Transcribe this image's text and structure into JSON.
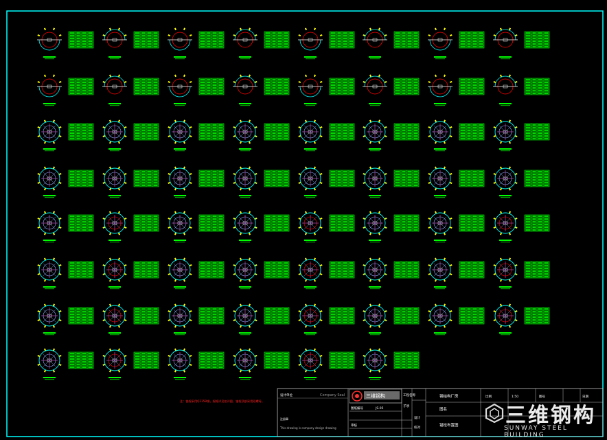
{
  "drawing": {
    "background": "#000000",
    "frame_color": "#00ffff",
    "grid_color": "#00ff00",
    "ring_color": "#00ffff",
    "accent_color": "#ff0000",
    "marker_color": "#ffff00",
    "rows": [
      8,
      8,
      8,
      8,
      8,
      8,
      8,
      6
    ],
    "half_section_rows": [
      0,
      1
    ]
  },
  "title_block": {
    "company_cn": "三维钢构",
    "company_seal": "Company Seal",
    "owner_note": "This drawing is company design drawing",
    "project": "钢结构厂房",
    "drawing_name": "锚栓布置图",
    "scale_label": "比例",
    "scale_value": "1:50",
    "sheet_label": "图号",
    "sheet_value": "JS-05",
    "red_note": "注：锚栓采用Q235B钢，规格详见各详图，锚栓顶部采用双螺母。",
    "cells": [
      "设计单位",
      "注册章",
      "图纸编号",
      "审核",
      "工程名称",
      "子项",
      "设计",
      "校对",
      "图名",
      "日期"
    ]
  },
  "watermark": {
    "logo_text": "三维钢构",
    "logo_subtext": "SUNWAY STEEL BUILDING"
  }
}
